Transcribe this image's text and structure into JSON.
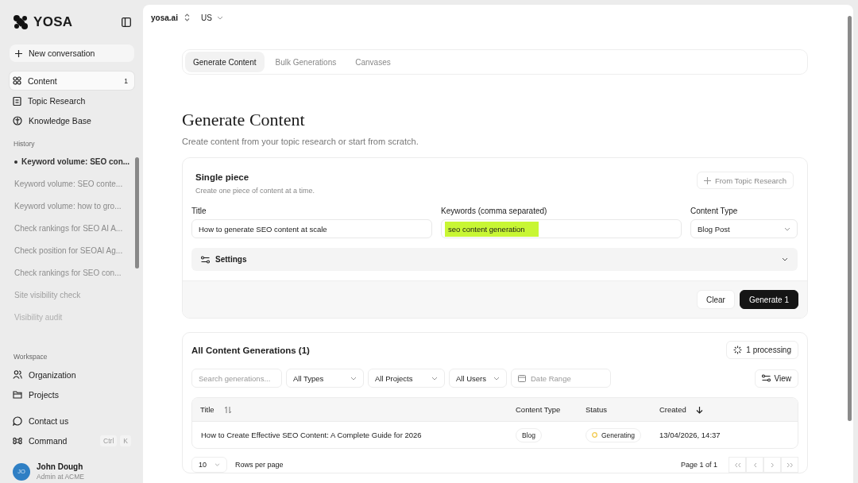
{
  "sidebar": {
    "brand": "YOSA",
    "new_conversation": "New conversation",
    "nav": [
      {
        "label": "Content",
        "badge": "1",
        "selected": true,
        "kind": "grid"
      },
      {
        "label": "Topic Research",
        "selected": false,
        "kind": "clipboard"
      },
      {
        "label": "Knowledge Base",
        "selected": false,
        "kind": "book"
      }
    ],
    "history_label": "History",
    "history": [
      {
        "label": "Keyword volume: SEO con...",
        "selected": true
      },
      {
        "label": "Keyword volume: SEO conte...",
        "selected": false
      },
      {
        "label": "Keyword volume: how to gro...",
        "selected": false
      },
      {
        "label": "Check rankings for SEO AI A...",
        "selected": false
      },
      {
        "label": "Check position for SEOAI Ag...",
        "selected": false
      },
      {
        "label": "Check rankings for SEO con...",
        "selected": false
      },
      {
        "label": "Site visibility check",
        "selected": false
      },
      {
        "label": "Visibility audit",
        "selected": false
      }
    ],
    "workspace_label": "Workspace",
    "workspace": [
      {
        "label": "Organization",
        "kind": "users"
      },
      {
        "label": "Projects",
        "kind": "folder"
      }
    ],
    "contact": "Contact us",
    "command": "Command",
    "shortcut": [
      "Ctrl",
      "K"
    ],
    "user": {
      "initials": "JO",
      "name": "John Dough",
      "role": "Admin at ACME"
    }
  },
  "topbar": {
    "site": "yosa.ai",
    "region": "US"
  },
  "tabs": [
    {
      "label": "Generate Content",
      "selected": true
    },
    {
      "label": "Bulk Generations",
      "selected": false
    },
    {
      "label": "Canvases",
      "selected": false
    }
  ],
  "heading": "Generate Content",
  "subheading": "Create content from your topic research or start from scratch.",
  "single": {
    "title": "Single piece",
    "description": "Create one piece of content at a time.",
    "from_research": "From Topic Research",
    "fields": [
      {
        "label": "Title",
        "value": "How to generate SEO content at scale",
        "kind": "text",
        "highlighted": false
      },
      {
        "label": "Keywords (comma separated)",
        "value": "seo content generation",
        "kind": "text",
        "highlighted": true
      },
      {
        "label": "Content Type",
        "value": "Blog Post",
        "kind": "select",
        "highlighted": false
      }
    ],
    "settings": "Settings",
    "expanded": false,
    "clear": "Clear",
    "generate": "Generate 1"
  },
  "generations": {
    "title": "All Content Generations (1)",
    "processing": "1 processing",
    "search": {
      "placeholder": "Search generations..."
    },
    "filters": [
      "All Types",
      "All Projects",
      "All Users"
    ],
    "date_range": "Date Range",
    "view": "View",
    "columns": [
      {
        "label": "Title",
        "kind": "sortable"
      },
      {
        "label": "Content Type",
        "kind": "plain"
      },
      {
        "label": "Status",
        "kind": "plain"
      },
      {
        "label": "Created",
        "kind": "descending"
      }
    ],
    "rows": [
      {
        "title": "How to Create Effective SEO Content: A Complete Guide for 2026",
        "type": "Blog",
        "status": "Generating",
        "created": "13/04/2026, 14:37"
      }
    ],
    "page_size": "10",
    "rows_per_page": "Rows per page",
    "page": "Page 1 of 1"
  }
}
